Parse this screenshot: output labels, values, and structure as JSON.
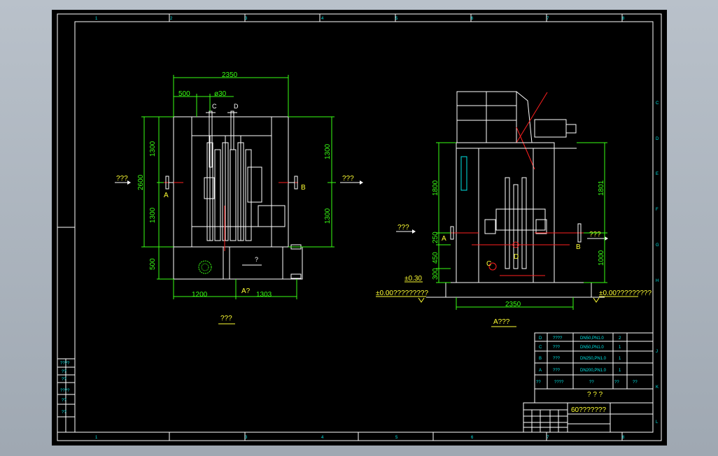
{
  "frame": {
    "col_markers_top": [
      "1",
      "2",
      "3",
      "4",
      "5",
      "6",
      "7",
      "8"
    ],
    "col_markers_bottom": [
      "1",
      "3",
      "4",
      "5",
      "6",
      "7",
      "8"
    ],
    "row_markers": [
      "C",
      "D",
      "E",
      "F",
      "G",
      "H",
      "J",
      "K",
      "L"
    ]
  },
  "front_view": {
    "title": "???",
    "dims": {
      "overall_width": "2350",
      "left_offset": "500",
      "pipe_dia": "ø30",
      "upper_height_left": "1300",
      "total_height": "2600",
      "lower_height_left": "1300",
      "base_height": "500",
      "upper_height_right": "1300",
      "lower_height_right": "1300",
      "bottom_left": "1200",
      "bottom_right": "1303",
      "section_mark": "A?"
    },
    "labels": {
      "port_c": "C",
      "port_d": "D",
      "port_a": "A",
      "port_b": "B",
      "flow_left": "???",
      "flow_right": "???",
      "note_q": "?"
    }
  },
  "side_view": {
    "title": "A???",
    "dims": {
      "upper_height": "1800",
      "right_height": "1801",
      "d450": "450",
      "d250": "250",
      "d300": "300",
      "level": "±0.30",
      "right_lower": "1000",
      "width": "2350",
      "ground_left": "±0.00?????????",
      "ground_right": "±0.00?????????"
    },
    "labels": {
      "port_a": "A",
      "port_b": "B",
      "port_c": "C",
      "port_d": "D",
      "flow_left": "???",
      "flow_right": "???"
    }
  },
  "parts_table": {
    "rows": [
      {
        "mark": "D",
        "name": "????",
        "spec": "DN50,PN1.0",
        "qty": "2"
      },
      {
        "mark": "C",
        "name": "???",
        "spec": "DN50,PN1.0",
        "qty": "1"
      },
      {
        "mark": "B",
        "name": "???",
        "spec": "DN250,PN1.0",
        "qty": "1"
      },
      {
        "mark": "A",
        "name": "???",
        "spec": "DN200,PN1.0",
        "qty": "1"
      }
    ],
    "header": {
      "mark": "??",
      "name": "????",
      "spec": "??",
      "qty": "??",
      "note": "??"
    },
    "caption": "? ? ?"
  },
  "title_block": {
    "name": "60???????"
  },
  "revision_block": {
    "rows": [
      "????",
      "??",
      "??",
      "????",
      "??",
      "??"
    ]
  }
}
